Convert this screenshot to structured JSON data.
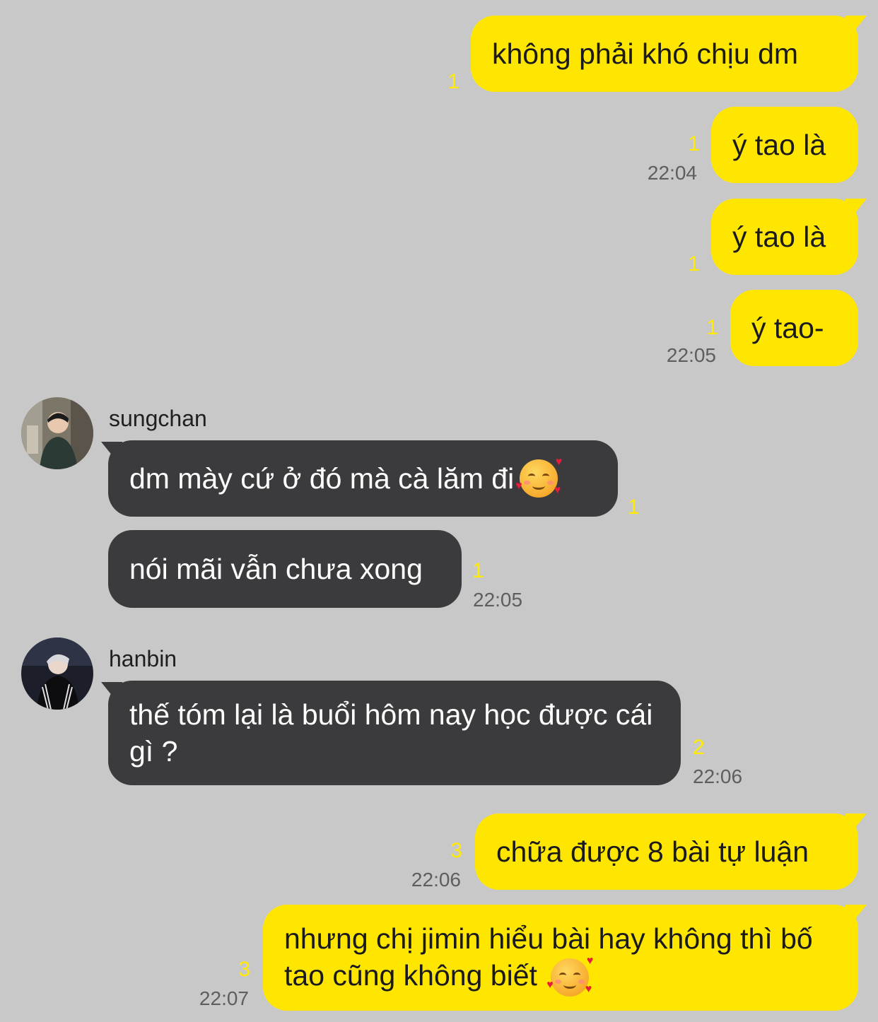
{
  "messages": [
    {
      "text": "không phải khó chịu dm",
      "count": "1"
    },
    {
      "text": "ý tao là",
      "count": "1",
      "time": "22:04"
    },
    {
      "text": "ý tao là",
      "count": "1"
    },
    {
      "text": "ý tao-",
      "count": "1",
      "time": "22:05"
    },
    {
      "sender": "sungchan",
      "text": "dm mày cứ ở đó mà cà lăm đi",
      "count": "1"
    },
    {
      "text": "nói mãi vẫn chưa xong",
      "count": "1",
      "time": "22:05"
    },
    {
      "sender": "hanbin",
      "text": "thế tóm lại là buổi hôm nay học được cái gì ?",
      "count": "2",
      "time": "22:06"
    },
    {
      "text": "chữa được 8 bài tự luận",
      "count": "3",
      "time": "22:06"
    },
    {
      "text": "nhưng chị jimin hiểu bài hay không thì bố tao cũng không biết",
      "count": "3",
      "time": "22:07"
    }
  ],
  "emoji": {
    "name": "smiling-face-with-hearts-icon"
  },
  "colors": {
    "background": "#c8c8c8",
    "outgoing_bubble": "#ffe600",
    "incoming_bubble": "#3b3b3d",
    "unread_count": "#ffea00",
    "timestamp": "#5e5e5e"
  }
}
